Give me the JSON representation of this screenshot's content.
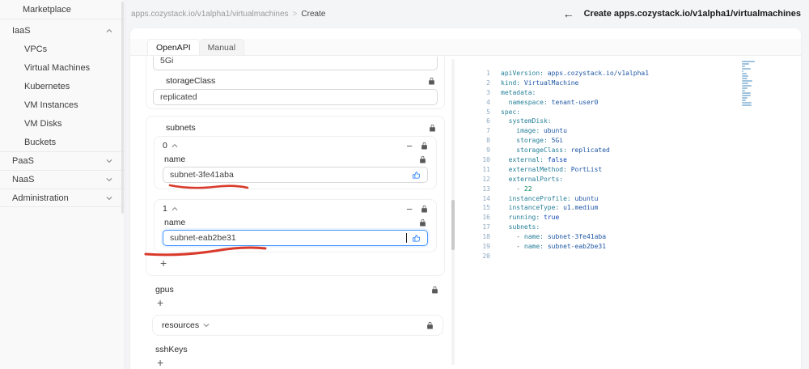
{
  "ui": {
    "annotation_color": "#da3a2b",
    "accent_color": "#1677ff"
  },
  "sidebar": {
    "items": [
      {
        "label": "Marketplace",
        "type": "top"
      },
      {
        "label": "IaaS",
        "type": "group",
        "chevron": "up"
      },
      {
        "label": "VPCs",
        "type": "sub"
      },
      {
        "label": "Virtual Machines",
        "type": "sub"
      },
      {
        "label": "Kubernetes",
        "type": "sub"
      },
      {
        "label": "VM Instances",
        "type": "sub"
      },
      {
        "label": "VM Disks",
        "type": "sub"
      },
      {
        "label": "Buckets",
        "type": "sub"
      },
      {
        "label": "PaaS",
        "type": "group",
        "chevron": "down",
        "divider_top": true
      },
      {
        "label": "NaaS",
        "type": "group",
        "chevron": "down",
        "divider_top": true
      },
      {
        "label": "Administration",
        "type": "group",
        "chevron": "down",
        "divider_top": true,
        "divider_bottom": true
      }
    ]
  },
  "breadcrumb": {
    "path": "apps.cozystack.io/v1alpha1/virtualmachines",
    "separator": ">",
    "current": "Create"
  },
  "header": {
    "back": "←",
    "title": "Create apps.cozystack.io/v1alpha1/virtualmachines"
  },
  "tabs": [
    {
      "label": "OpenAPI",
      "active": true
    },
    {
      "label": "Manual",
      "active": false
    }
  ],
  "form": {
    "storage_partial_value": "5Gi",
    "storageClass": {
      "label": "storageClass",
      "value": "replicated"
    },
    "subnets": {
      "label": "subnets",
      "add": "+",
      "items": [
        {
          "index": "0",
          "field_label": "name",
          "value": "subnet-3fe41aba",
          "focused": false,
          "underlined": true
        },
        {
          "index": "1",
          "field_label": "name",
          "value": "subnet-eab2be31",
          "focused": true,
          "underlined": true
        }
      ]
    },
    "gpus": {
      "label": "gpus",
      "add": "+"
    },
    "resources": {
      "label": "resources"
    },
    "sshKeys": {
      "label": "sshKeys",
      "add": "+"
    }
  },
  "editor": {
    "lines": [
      {
        "n": 1,
        "s": [
          [
            "k",
            "apiVersion:"
          ],
          [
            "v",
            " apps.cozystack.io/v1alpha1"
          ]
        ]
      },
      {
        "n": 2,
        "s": [
          [
            "k",
            "kind:"
          ],
          [
            "v",
            " VirtualMachine"
          ]
        ]
      },
      {
        "n": 3,
        "s": [
          [
            "k",
            "metadata:"
          ]
        ]
      },
      {
        "n": 4,
        "s": [
          [
            "p",
            "  "
          ],
          [
            "k",
            "namespace:"
          ],
          [
            "v",
            " tenant-user0"
          ]
        ]
      },
      {
        "n": 5,
        "s": [
          [
            "k",
            "spec:"
          ]
        ]
      },
      {
        "n": 6,
        "s": [
          [
            "p",
            "  "
          ],
          [
            "k",
            "systemDisk:"
          ]
        ]
      },
      {
        "n": 7,
        "s": [
          [
            "p",
            "    "
          ],
          [
            "k",
            "image:"
          ],
          [
            "v",
            " ubuntu"
          ]
        ]
      },
      {
        "n": 8,
        "s": [
          [
            "p",
            "    "
          ],
          [
            "k",
            "storage:"
          ],
          [
            "v",
            " 5Gi"
          ]
        ]
      },
      {
        "n": 9,
        "s": [
          [
            "p",
            "    "
          ],
          [
            "k",
            "storageClass:"
          ],
          [
            "v",
            " replicated"
          ]
        ]
      },
      {
        "n": 10,
        "s": [
          [
            "p",
            "  "
          ],
          [
            "k",
            "external:"
          ],
          [
            "b",
            " false"
          ]
        ]
      },
      {
        "n": 11,
        "s": [
          [
            "p",
            "  "
          ],
          [
            "k",
            "externalMethod:"
          ],
          [
            "v",
            " PortList"
          ]
        ]
      },
      {
        "n": 12,
        "s": [
          [
            "p",
            "  "
          ],
          [
            "k",
            "externalPorts:"
          ]
        ]
      },
      {
        "n": 13,
        "s": [
          [
            "p",
            "    - "
          ],
          [
            "n",
            "22"
          ]
        ]
      },
      {
        "n": 14,
        "s": [
          [
            "p",
            "  "
          ],
          [
            "k",
            "instanceProfile:"
          ],
          [
            "v",
            " ubuntu"
          ]
        ]
      },
      {
        "n": 15,
        "s": [
          [
            "p",
            "  "
          ],
          [
            "k",
            "instanceType:"
          ],
          [
            "v",
            " u1.medium"
          ]
        ]
      },
      {
        "n": 16,
        "s": [
          [
            "p",
            "  "
          ],
          [
            "k",
            "running:"
          ],
          [
            "b",
            " true"
          ]
        ]
      },
      {
        "n": 17,
        "s": [
          [
            "p",
            "  "
          ],
          [
            "k",
            "subnets:"
          ]
        ]
      },
      {
        "n": 18,
        "s": [
          [
            "p",
            "    - "
          ],
          [
            "k",
            "name:"
          ],
          [
            "v",
            " subnet-3fe41aba"
          ]
        ]
      },
      {
        "n": 19,
        "s": [
          [
            "p",
            "    - "
          ],
          [
            "k",
            "name:"
          ],
          [
            "v",
            " subnet-eab2be31"
          ]
        ]
      },
      {
        "n": 20,
        "s": []
      }
    ]
  }
}
